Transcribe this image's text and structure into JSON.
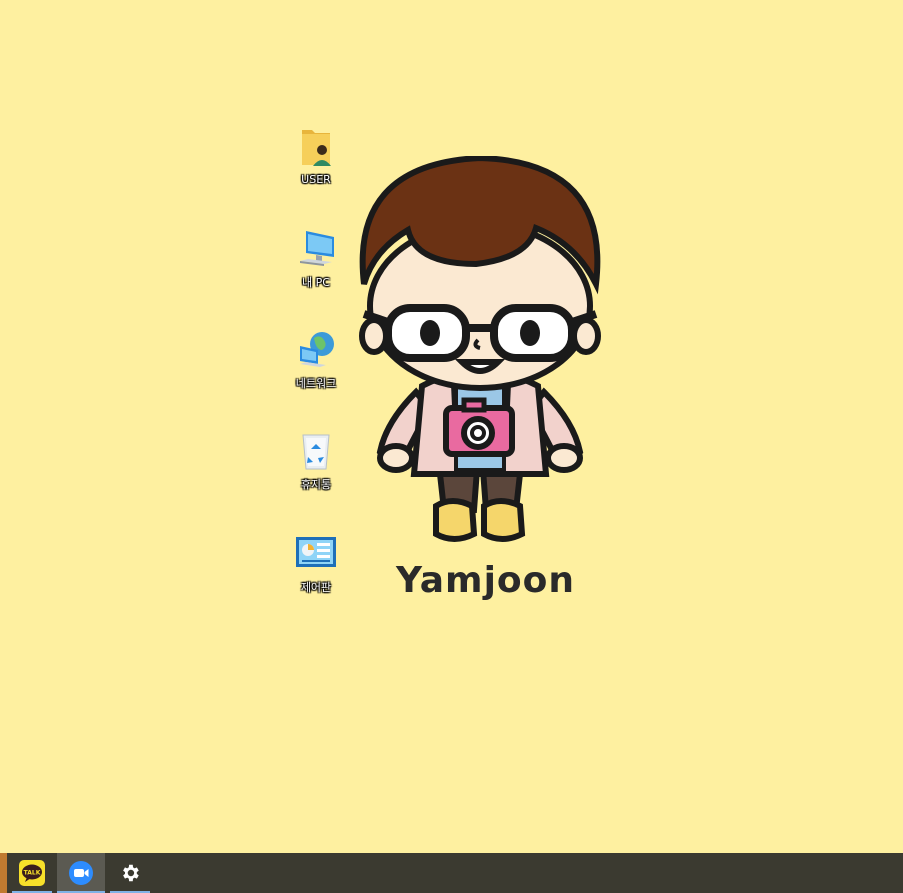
{
  "desktop_icons": [
    {
      "name": "user-folder-icon",
      "label": "USER"
    },
    {
      "name": "this-pc-icon",
      "label": "내 PC"
    },
    {
      "name": "network-icon",
      "label": "네트워크"
    },
    {
      "name": "recycle-bin-icon",
      "label": "휴지통"
    },
    {
      "name": "control-panel-icon",
      "label": "제어판"
    }
  ],
  "wallpaper": {
    "name_text": "Yamjoon"
  },
  "taskbar": {
    "items": [
      {
        "icon": "kakaotalk-icon",
        "label": "TALK"
      },
      {
        "icon": "zoom-icon",
        "label": ""
      },
      {
        "icon": "settings-gear-icon",
        "label": ""
      }
    ],
    "accent_color": "#7fb2e6"
  },
  "colors": {
    "background": "#fef0a0",
    "taskbar": "#3b3a30"
  }
}
